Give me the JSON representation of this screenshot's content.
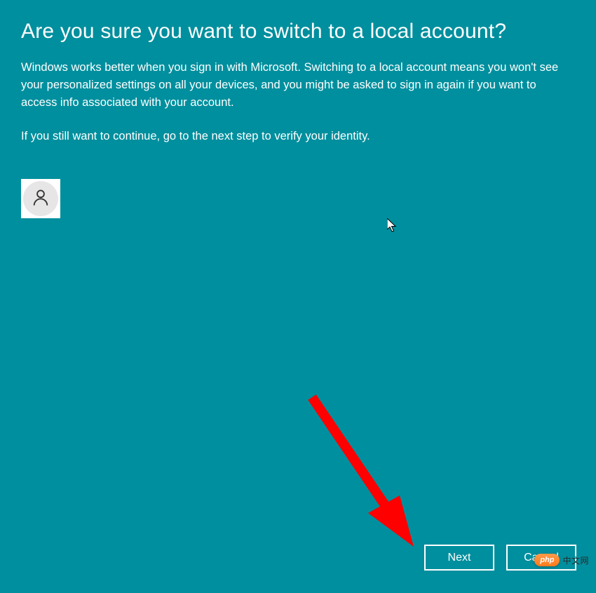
{
  "title": "Are you sure you want to switch to a local account?",
  "paragraph1": "Windows works better when you sign in with Microsoft. Switching to a local account means you won't see your personalized settings on all your devices, and you might be asked to sign in again if you want to access info associated with your account.",
  "paragraph2": "If you still want to continue, go to the next step to verify your identity.",
  "buttons": {
    "next": "Next",
    "cancel": "Cancel"
  },
  "watermark": {
    "badge": "php",
    "text": "中文网"
  }
}
